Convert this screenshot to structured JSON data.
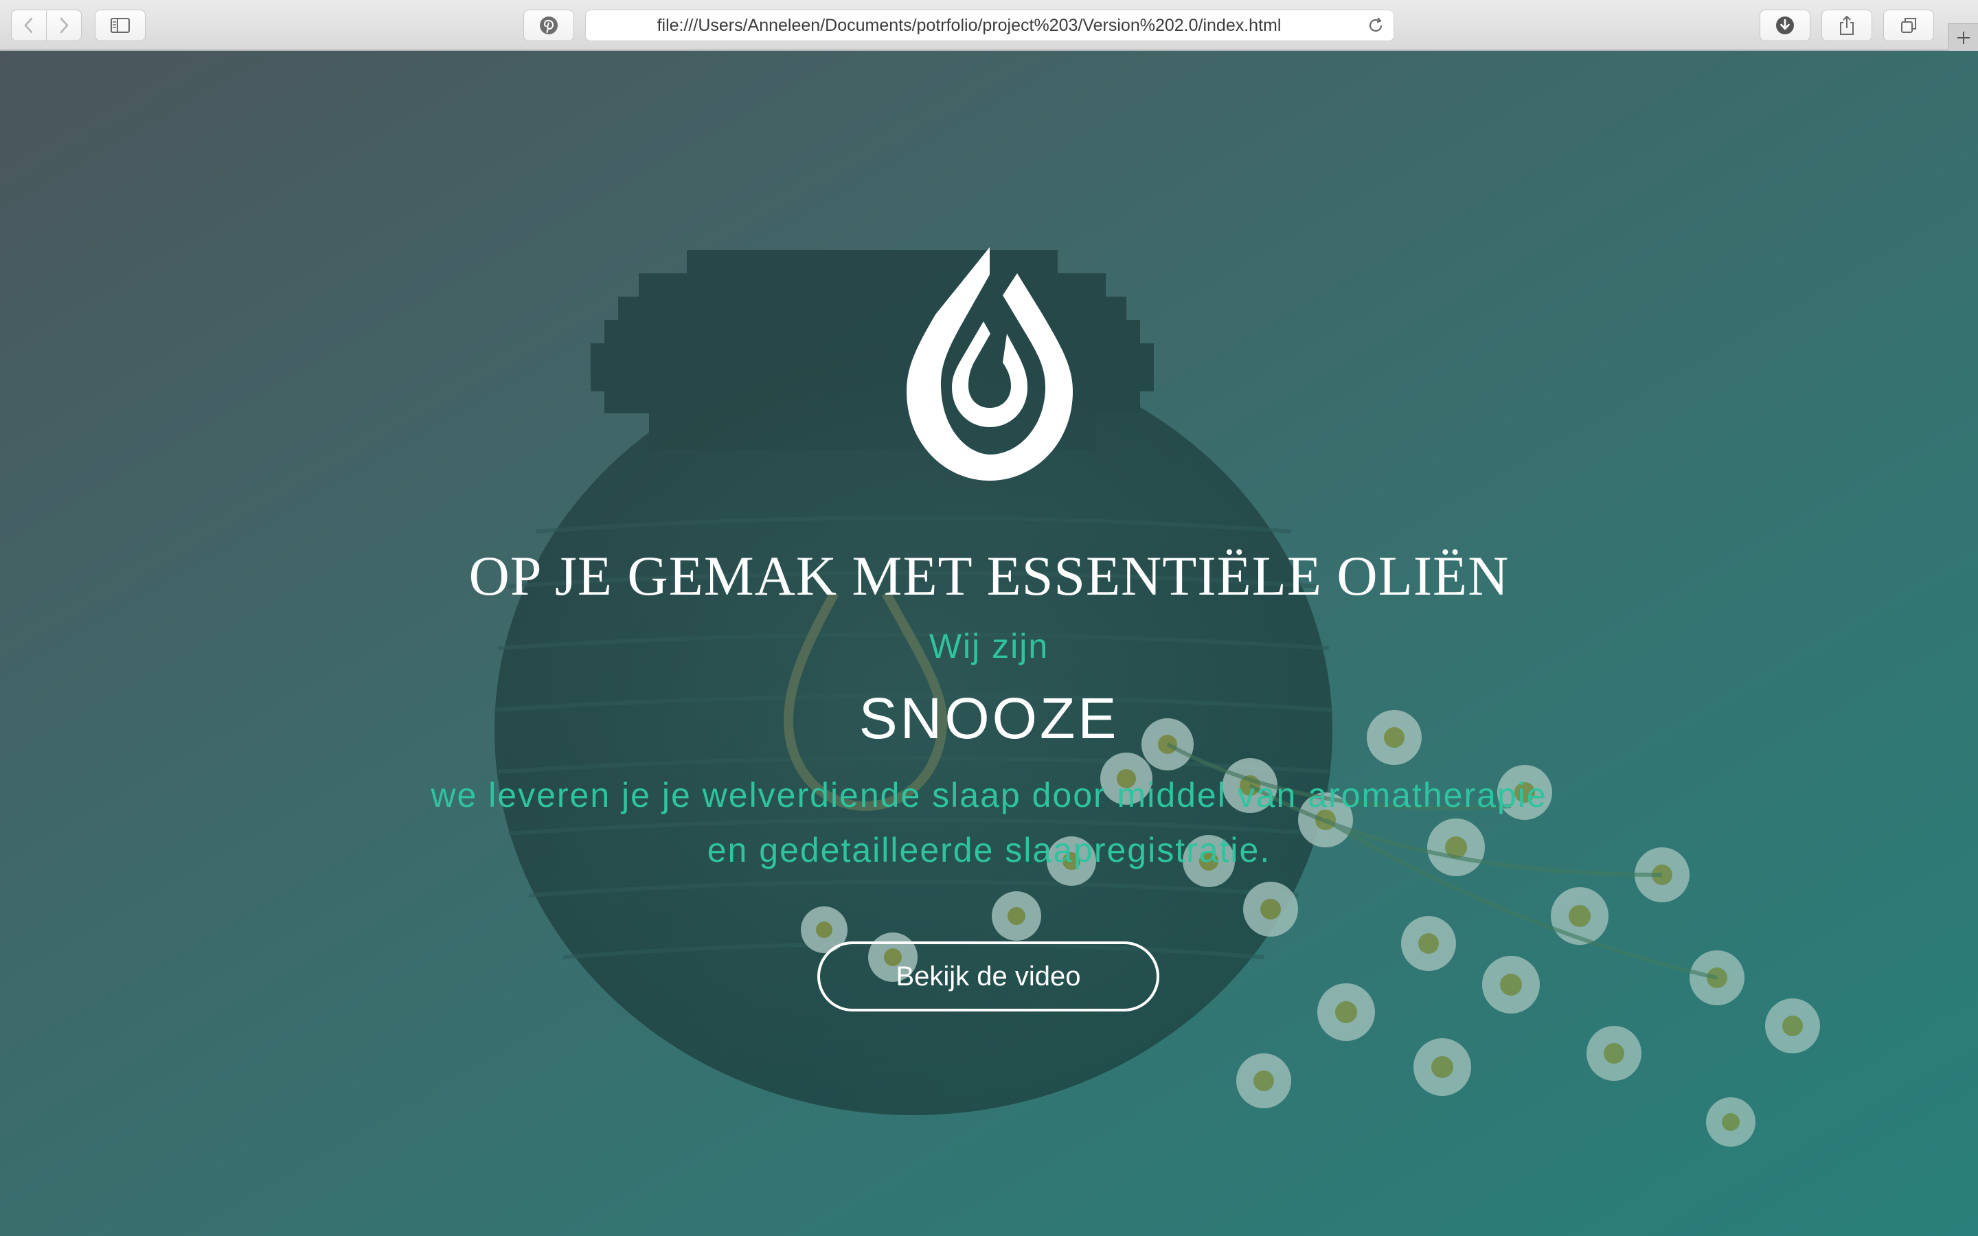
{
  "browser": {
    "url": "file:///Users/Anneleen/Documents/potrfolio/project%203/Version%202.0/index.html",
    "toolbar": {
      "back_icon": "chevron-left-icon",
      "forward_icon": "chevron-right-icon",
      "sidebar_icon": "sidebar-icon",
      "pinterest_icon": "pinterest-icon",
      "reload_icon": "reload-icon",
      "download_icon": "download-icon",
      "share_icon": "share-icon",
      "tabs_icon": "tabs-overview-icon",
      "new_tab_icon": "plus-icon"
    }
  },
  "hero": {
    "logo": "water-drop-logo",
    "headline": "OP JE GEMAK MET ESSENTIËLE OLIËN",
    "intro": "Wij zijn",
    "brand": "SNOOZE",
    "tagline_line1": "we leveren je je welverdiende slaap door middel van aromatherapie",
    "tagline_line2": "en gedetailleerde slaapregistratie.",
    "cta_label": "Bekijk de video"
  },
  "colors": {
    "accent": "#2ec4a0",
    "text_light": "#ffffff",
    "overlay_dark": "#4d5a5e",
    "overlay_teal": "#2f7e7a"
  }
}
